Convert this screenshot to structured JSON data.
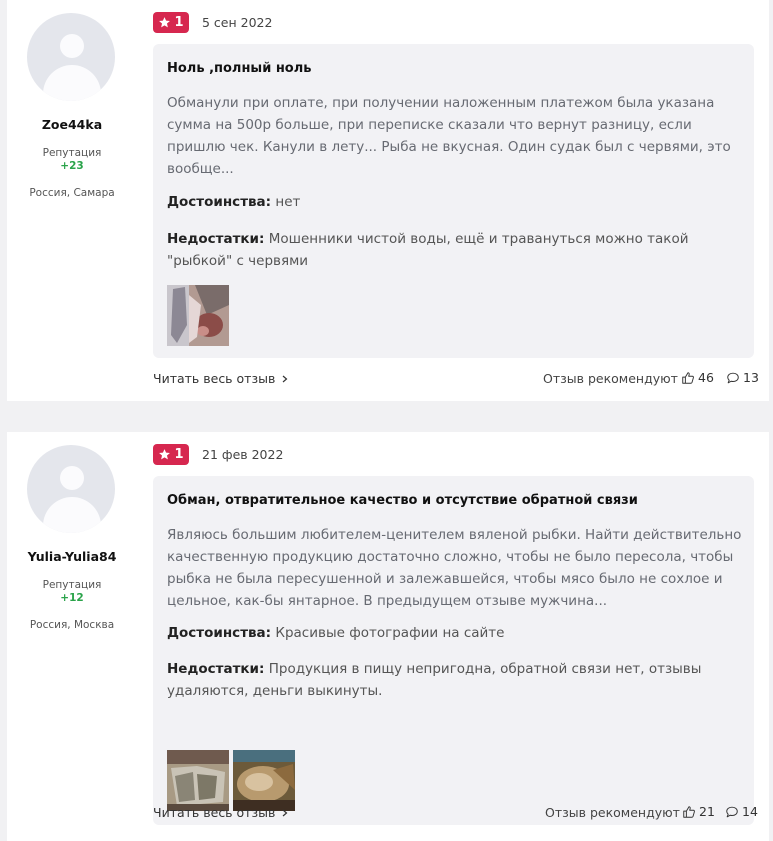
{
  "reviews": [
    {
      "author": {
        "name": "Zoe44ka",
        "reputation_label": "Репутация",
        "reputation": "+23",
        "location": "Россия, Самара"
      },
      "rating": "1",
      "date": "5 сен 2022",
      "title": "Ноль ,полный ноль",
      "text": "Обманули при оплате, при получении наложенным платежом была указана сумма на 500р больше, при переписке сказали что вернут разницу, если пришлю чек. Канули в лету... Рыба не вкусная. Один судак был с червями, это вообще...",
      "pros_label": "Достоинства:",
      "pros": "нет",
      "cons_label": "Недостатки:",
      "cons": "Мошенники чистой воды, ещё и травануться можно такой \"рыбкой\" с червями",
      "read_all": "Читать весь отзыв",
      "recommend_label": "Отзыв рекомендуют",
      "likes": "46",
      "comments": "13"
    },
    {
      "author": {
        "name": "Yulia-Yulia84",
        "reputation_label": "Репутация",
        "reputation": "+12",
        "location": "Россия, Москва"
      },
      "rating": "1",
      "date": "21 фев 2022",
      "title": "Обман, отвратительное качество и отсутствие обратной связи",
      "text": "Являюсь большим любителем-ценителем вяленой рыбки. Найти действительно качественную продукцию достаточно сложно, чтобы не было пересола, чтобы рыбка не была пересушенной и залежавшейся, чтобы мясо было не сохлое и цельное, как-бы янтарное. В предыдущем отзыве мужчина...",
      "pros_label": "Достоинства:",
      "pros": "Красивые фотографии на сайте",
      "cons_label": "Недостатки:",
      "cons": "Продукция в пищу непригодна, обратной связи нет, отзывы удаляются, деньги выкинуты.",
      "read_all": "Читать весь отзыв",
      "recommend_label": "Отзыв рекомендуют",
      "likes": "21",
      "comments": "14"
    }
  ],
  "colors": {
    "accent": "#d6274f",
    "reputation": "#2aa34a",
    "body_bg": "#f2f2f5"
  },
  "icons": {
    "rating": "star-icon",
    "more": "chevron-right-icon",
    "likes": "thumbs-up-icon",
    "comments": "speech-bubble-icon",
    "avatar": "user-silhouette-icon"
  }
}
